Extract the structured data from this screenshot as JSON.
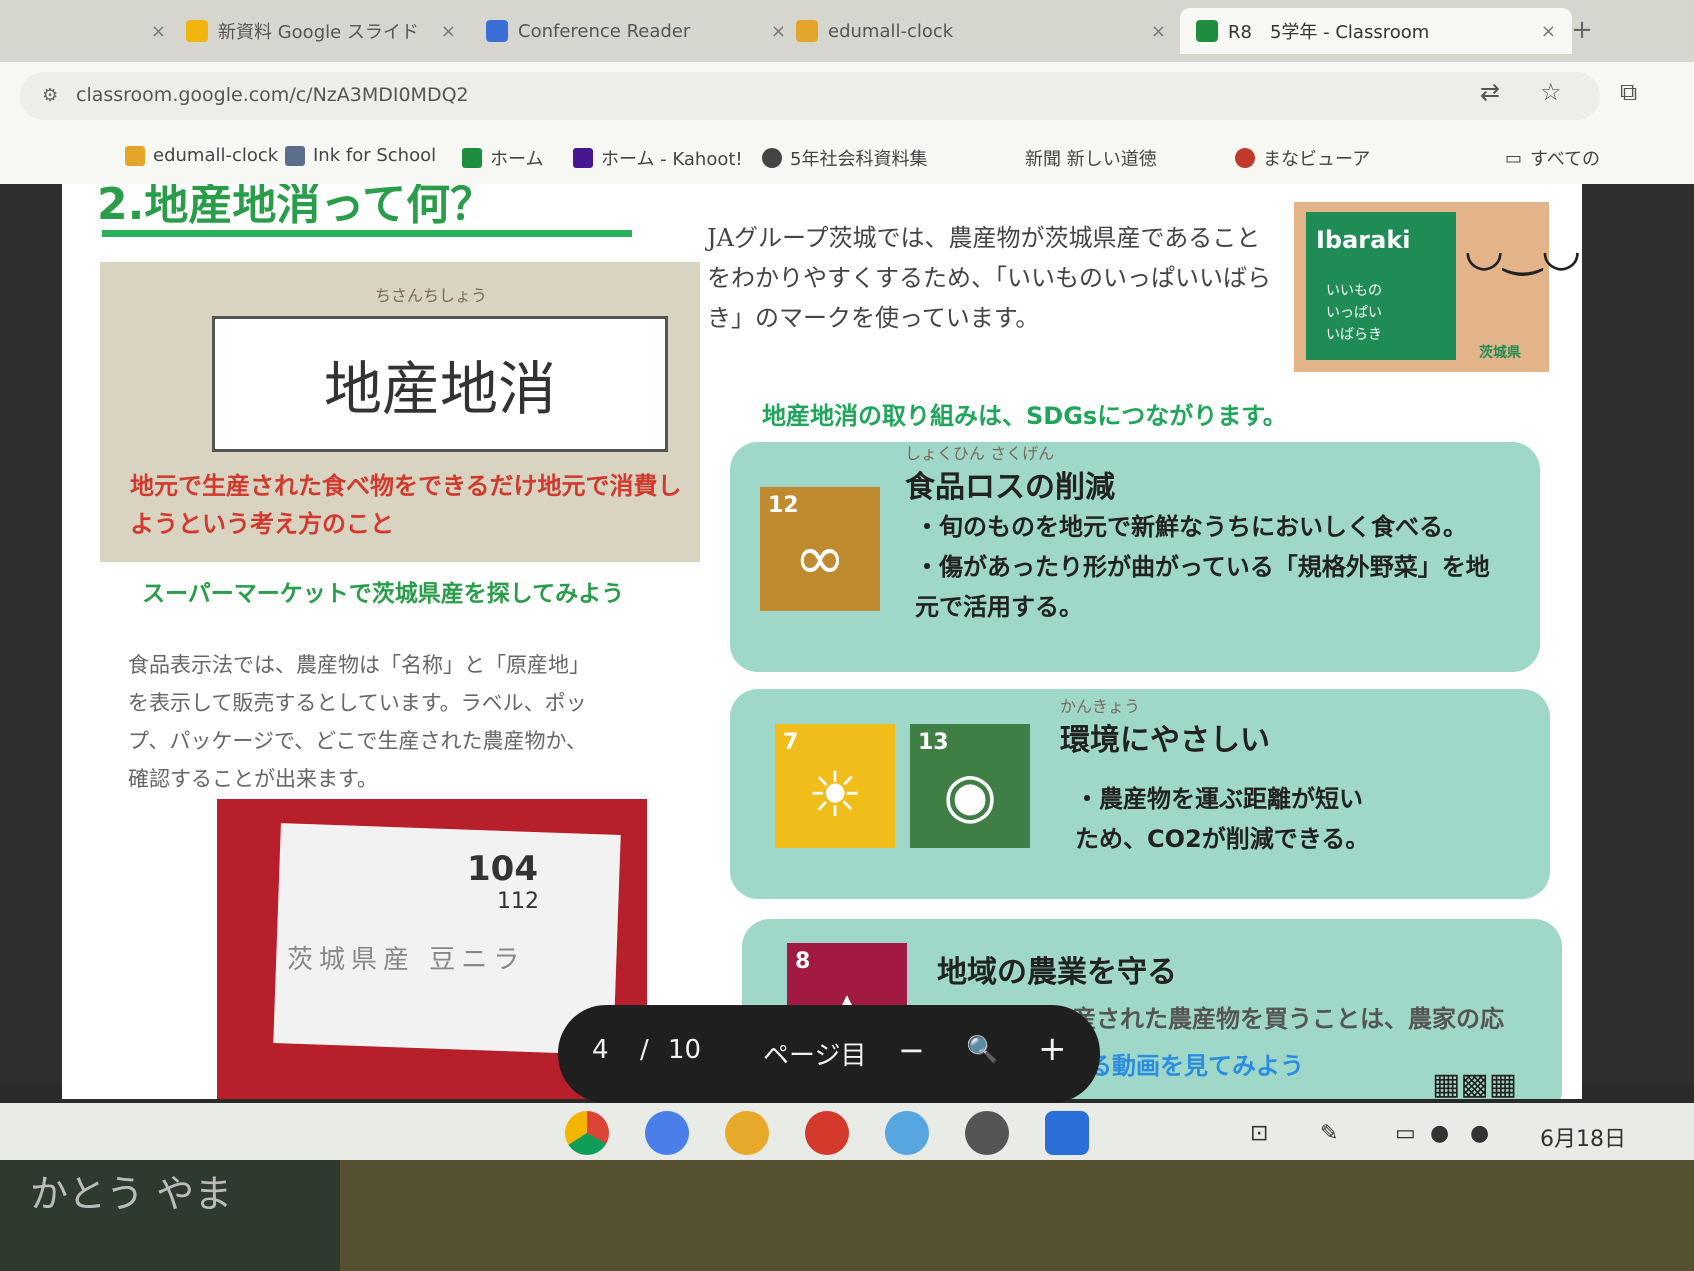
{
  "browser": {
    "tabs": [
      {
        "label": "",
        "fav": "#8b8b8b"
      },
      {
        "label": "新資料 Google スライド",
        "fav": "#f2b40f"
      },
      {
        "label": "Conference Reader",
        "fav": "#3a6fd8"
      },
      {
        "label": "edumall-clock",
        "fav": "#e4a62a"
      },
      {
        "label": "R8　5学年 - Classroom",
        "fav": "#1e8e3e"
      }
    ],
    "url": "classroom.google.com/c/NzA3MDI0MDQ2",
    "bookmarks": [
      {
        "label": "edumall-clock",
        "fav": "#e4a62a"
      },
      {
        "label": "Ink for School",
        "fav": "#5b6f8c"
      },
      {
        "label": "ホーム",
        "fav": "#1e8e3e"
      },
      {
        "label": "ホーム - Kahoot!",
        "fav": "#46178f"
      },
      {
        "label": "5年社会科資料集",
        "fav": "#444"
      },
      {
        "label": "新聞 新しい道徳",
        "fav": "#999"
      },
      {
        "label": "まなビューア",
        "fav": "#c0392b"
      },
      {
        "label": "すべての",
        "fav": "#666"
      }
    ]
  },
  "slide": {
    "title": "2.地産地消って何？",
    "def_ruby": "ちさんちしょう",
    "def_word": "地産地消",
    "def_text": "地元で生産された食べ物をできるだけ地元で消費しようという考え方のこと",
    "intro": "JAグループ茨城では、農産物が茨城県産であることをわかりやすくするため、「いいものいっぱいいばらき」のマークを使っています。",
    "logo": {
      "title": "Ibaraki",
      "lines": [
        "いいもの",
        "いっぱい",
        "いばらき"
      ],
      "tag": "茨城県"
    },
    "sdg_lead": "地産地消の取り組みは、SDGsにつながります。",
    "super_title": "スーパーマーケットで茨城県産を探してみよう",
    "super_body": "食品表示法では、農産物は「名称」と「原産地」を表示して販売するとしています。ラベル、ポップ、パッケージで、どこで生産された農産物か、確認することが出来ます。",
    "photo": {
      "price": "104",
      "price2": "112",
      "text": "茨城県産 豆ニラ"
    },
    "cards": [
      {
        "title": "食品ロスの削減",
        "ruby": "しょくひん さくげん",
        "lines": [
          "・旬のものを地元で新鮮なうちにおいしく食べる。",
          "・傷があったり形が曲がっている「規格外野菜」を地元で活用する。"
        ],
        "goals": [
          {
            "num": "12",
            "color": "#bf8b2e",
            "glyph": "∞"
          }
        ]
      },
      {
        "title": "環境にやさしい",
        "ruby": "かんきょう",
        "lines": [
          "・農産物を運ぶ距離が短いため、CO2が削減できる。"
        ],
        "goals": [
          {
            "num": "7",
            "color": "#f1bd1b",
            "glyph": "☀"
          },
          {
            "num": "13",
            "color": "#3f7e44",
            "glyph": "◉"
          }
        ]
      },
      {
        "title": "地域の農業を守る",
        "ruby": "",
        "lines": [
          "・地元で生産された農産物を買うことは、農家の応援になる。"
        ],
        "goals": [
          {
            "num": "8",
            "color": "#a21942",
            "glyph": "▲"
          }
        ]
      }
    ],
    "bottom_link": "地産地消に関する動画を見てみよう"
  },
  "pagebar": {
    "current": "4",
    "sep": "/",
    "total": "10",
    "fit": "ページ目",
    "minus": "−",
    "zoom": "🔍",
    "plus": "+"
  },
  "taskbar": {
    "date": "6月18日"
  },
  "shelf": {
    "text": "かとう\nやま"
  }
}
